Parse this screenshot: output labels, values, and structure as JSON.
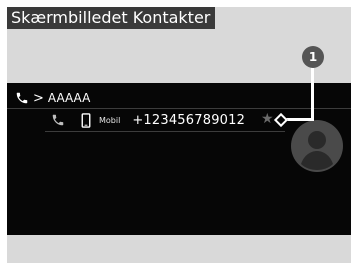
{
  "title": "Skærmbilledet Kontakter",
  "breadcrumb": {
    "chevron": ">",
    "contact_name": "AAAAA"
  },
  "entry": {
    "type_label": "Mobil",
    "number": "+123456789012",
    "favorite_symbol": "★"
  },
  "callout": {
    "number": "1"
  },
  "icons": {
    "breadcrumb": "phone-icon",
    "call": "phone-icon",
    "type": "mobile-phone-icon",
    "favorite": "star-icon",
    "avatar": "contact-avatar-icon"
  },
  "colors": {
    "screen_bg": "#060606",
    "frame_bg": "#d9d9d9",
    "title_bg": "#3a3a3a",
    "badge_bg": "#555555",
    "text": "#ffffff",
    "star_inactive": "#6a6a6a"
  }
}
